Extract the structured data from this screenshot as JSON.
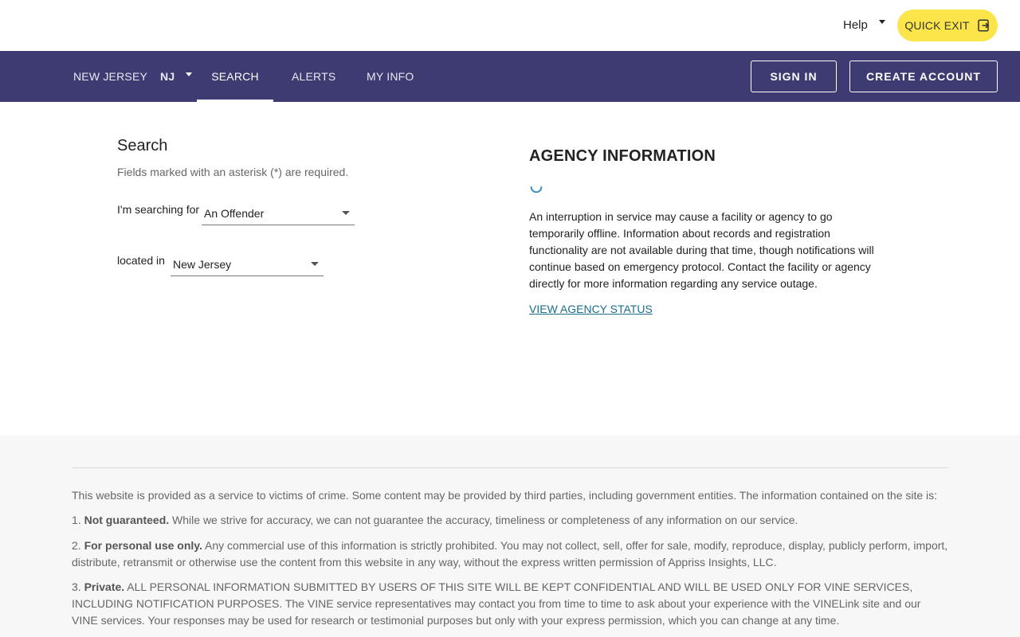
{
  "topbar": {
    "help_label": "Help",
    "quick_exit_label": "QUICK EXIT"
  },
  "nav": {
    "state_name": "NEW JERSEY",
    "state_code": "NJ",
    "search_label": "SEARCH",
    "alerts_label": "ALERTS",
    "myinfo_label": "MY INFO",
    "signin_label": "SIGN IN",
    "create_account_label": "CREATE ACCOUNT",
    "bar_color": "#3d3b72"
  },
  "search": {
    "title": "Search",
    "note": "Fields marked with an asterisk (*) are required.",
    "searching_for_label": "I'm searching for",
    "searching_for_value": "An Offender",
    "located_in_label": "located in",
    "located_in_value": "New Jersey"
  },
  "agency": {
    "title": "AGENCY INFORMATION",
    "body": "An interruption in service may cause a facility or agency to go temporarily offline. Information about records and registration functionality are not available during that time, though notifications will continue based on emergency protocol. Contact the facility or agency directly for more information regarding any service outage.",
    "link_label": "VIEW AGENCY STATUS"
  },
  "footer": {
    "intro": "This website is provided as a service to victims of crime. Some content may be provided by third parties, including government entities. The information contained on the site is:",
    "item1_prefix": "1. ",
    "item1_bold": "Not guaranteed.",
    "item1_text": " While we strive for accuracy, we can not guarantee the accuracy, timeliness or completeness of any information on our service.",
    "item2_prefix": "2. ",
    "item2_bold": "For personal use only.",
    "item2_text": " Any commercial use of this information is strictly prohibited. You may not collect, sell, offer for sale, modify, reproduce, display, publicly perform, import, distribute, retransmit or otherwise use the content from this website in any way, without the express written permission of Appriss Insights, LLC.",
    "item3_prefix": "3. ",
    "item3_bold": "Private.",
    "item3_text": " ALL PERSONAL INFORMATION SUBMITTED BY USERS OF THIS SITE WILL BE KEPT CONFIDENTIAL AND WILL BE USED ONLY FOR VINE SERVICES, INCLUDING NOTIFICATION PURPOSES. The VINE service representatives may contact you from time to time to ask about your experience with the VINELink site and our VINE services. Your responses may be used for research or testimonial purposes but only with your express permission, which you can change at any time."
  }
}
